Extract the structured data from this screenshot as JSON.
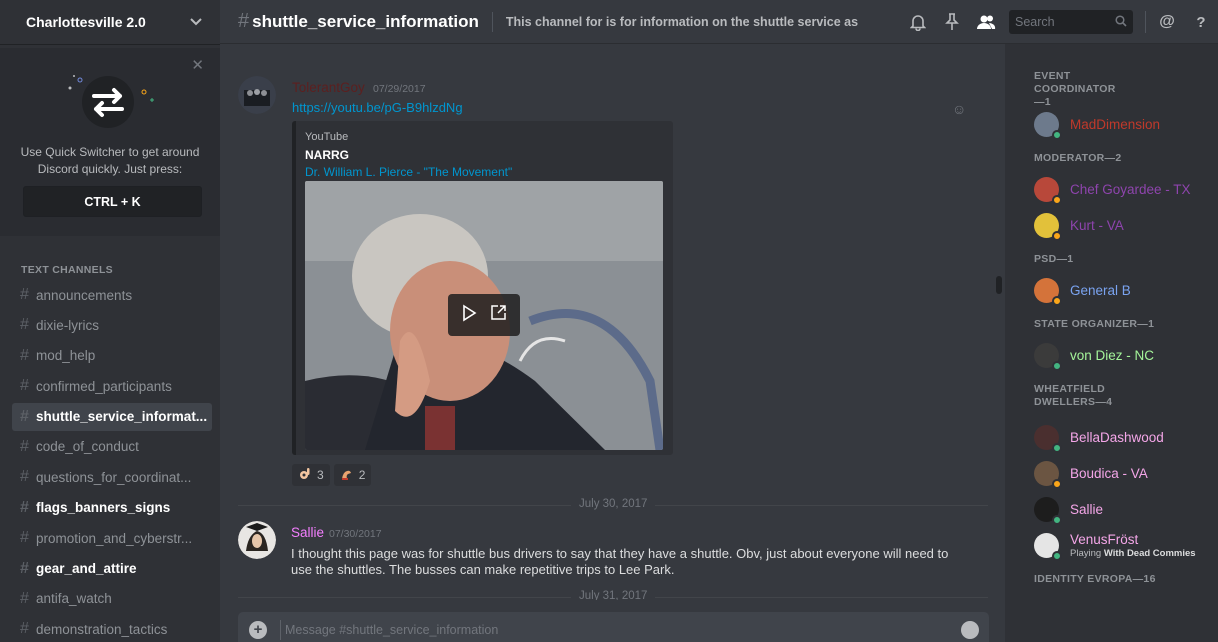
{
  "server": {
    "name": "Charlottesville 2.0"
  },
  "quick_switcher": {
    "text": "Use Quick Switcher to get around Discord quickly. Just press:",
    "shortcut": "CTRL + K"
  },
  "sidebar": {
    "category": "TEXT CHANNELS",
    "channels": [
      {
        "name": "announcements",
        "state": "normal"
      },
      {
        "name": "dixie-lyrics",
        "state": "normal"
      },
      {
        "name": "mod_help",
        "state": "normal"
      },
      {
        "name": "confirmed_participants",
        "state": "normal"
      },
      {
        "name": "shuttle_service_informat...",
        "state": "active"
      },
      {
        "name": "code_of_conduct",
        "state": "normal"
      },
      {
        "name": "questions_for_coordinat...",
        "state": "normal"
      },
      {
        "name": "flags_banners_signs",
        "state": "unread"
      },
      {
        "name": "promotion_and_cyberstr...",
        "state": "normal"
      },
      {
        "name": "gear_and_attire",
        "state": "unread"
      },
      {
        "name": "antifa_watch",
        "state": "normal"
      },
      {
        "name": "demonstration_tactics",
        "state": "normal"
      }
    ]
  },
  "topbar": {
    "channel": "shuttle_service_information",
    "topic": "This channel for is for information on the shuttle service as it bec...",
    "search_placeholder": "Search"
  },
  "messages": [
    {
      "author": "TolerantGoy",
      "author_color": "#5c1f1f",
      "timestamp": "07/29/2017",
      "link": "https://youtu.be/pG-B9hlzdNg",
      "embed": {
        "provider": "YouTube",
        "author": "NARRG",
        "title": "Dr. William L. Pierce - \"The Movement\""
      },
      "reactions": [
        {
          "emoji": "ok-hand-emoji",
          "count": "3"
        },
        {
          "emoji": "flexed-arm-emoji",
          "count": "2"
        }
      ]
    },
    {
      "author": "Sallie",
      "author_color": "#f47fff",
      "timestamp": "07/30/2017",
      "text": "I thought this page was for shuttle bus drivers to say that they have a shuttle.  Obv, just about everyone will need to use the shuttles.  The busses can make repetitive trips to  Lee Park."
    }
  ],
  "dividers": [
    "July 30, 2017",
    "July 31, 2017"
  ],
  "input": {
    "placeholder": "Message #shuttle_service_information"
  },
  "members": {
    "roles": [
      {
        "label": "EVENT COORDINATOR—1",
        "members": [
          {
            "name": "MadDimension",
            "color": "#c0392b",
            "status": "#43b581"
          }
        ]
      },
      {
        "label": "MODERATOR—2",
        "members": [
          {
            "name": "Chef Goyardee - TX",
            "color": "#8e44ad",
            "status": "#faa61a"
          },
          {
            "name": "Kurt - VA",
            "color": "#8e44ad",
            "status": "#faa61a"
          }
        ]
      },
      {
        "label": "PSD—1",
        "members": [
          {
            "name": "General B",
            "color": "#7aa3f0",
            "status": "#faa61a"
          }
        ]
      },
      {
        "label": "STATE ORGANIZER—1",
        "members": [
          {
            "name": "von Diez - NC",
            "color": "#a5f59a",
            "status": "#43b581"
          }
        ]
      },
      {
        "label": "WHEATFIELD DWELLERS—4",
        "members": [
          {
            "name": "BellaDashwood",
            "color": "#f4a6e8",
            "status": "#43b581"
          },
          {
            "name": "Boudica - VA",
            "color": "#f4a6e8",
            "status": "#faa61a"
          },
          {
            "name": "Sallie",
            "color": "#f4a6e8",
            "status": "#43b581"
          },
          {
            "name": "VenusFröst",
            "color": "#f4a6e8",
            "status": "#43b581",
            "activity_prefix": "Playing ",
            "activity": "With Dead Commies"
          }
        ]
      },
      {
        "label": "IDENTITY EVROPA—16",
        "members": []
      }
    ]
  }
}
